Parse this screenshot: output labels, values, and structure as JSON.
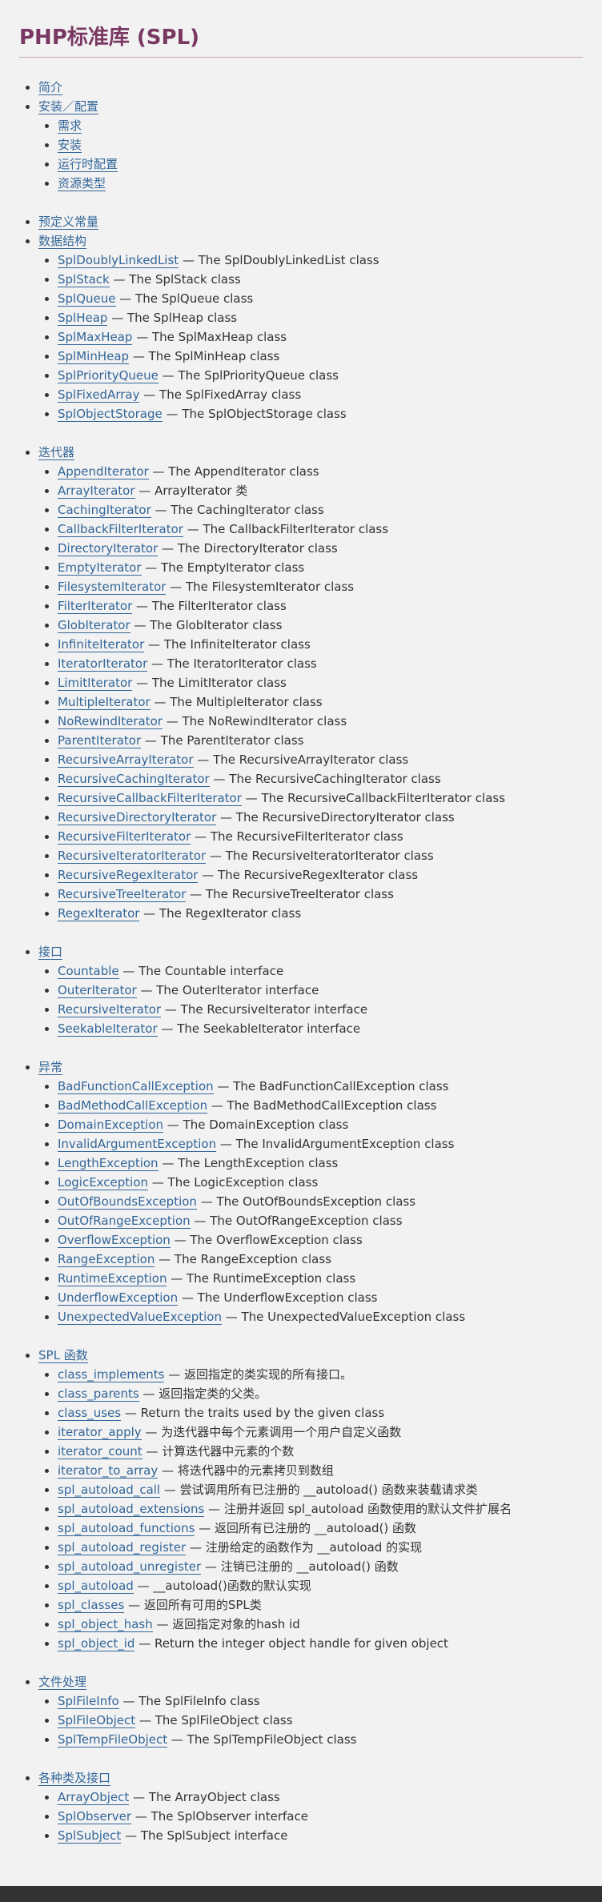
{
  "title": "PHP标准库 (SPL)",
  "separator": " — ",
  "sections": [
    {
      "label": "简介",
      "children": []
    },
    {
      "label": "安装／配置",
      "children": [
        {
          "link": "需求",
          "desc": ""
        },
        {
          "link": "安装",
          "desc": ""
        },
        {
          "link": "运行时配置",
          "desc": ""
        },
        {
          "link": "资源类型",
          "desc": ""
        }
      ]
    },
    {
      "label": "预定义常量",
      "children": []
    },
    {
      "label": "数据结构",
      "children": [
        {
          "link": "SplDoublyLinkedList",
          "desc": "The SplDoublyLinkedList class"
        },
        {
          "link": "SplStack",
          "desc": "The SplStack class"
        },
        {
          "link": "SplQueue",
          "desc": "The SplQueue class"
        },
        {
          "link": "SplHeap",
          "desc": "The SplHeap class"
        },
        {
          "link": "SplMaxHeap",
          "desc": "The SplMaxHeap class"
        },
        {
          "link": "SplMinHeap",
          "desc": "The SplMinHeap class"
        },
        {
          "link": "SplPriorityQueue",
          "desc": "The SplPriorityQueue class"
        },
        {
          "link": "SplFixedArray",
          "desc": "The SplFixedArray class"
        },
        {
          "link": "SplObjectStorage",
          "desc": "The SplObjectStorage class"
        }
      ]
    },
    {
      "label": "迭代器",
      "children": [
        {
          "link": "AppendIterator",
          "desc": "The AppendIterator class"
        },
        {
          "link": "ArrayIterator",
          "desc": "ArrayIterator 类"
        },
        {
          "link": "CachingIterator",
          "desc": "The CachingIterator class"
        },
        {
          "link": "CallbackFilterIterator",
          "desc": "The CallbackFilterIterator class"
        },
        {
          "link": "DirectoryIterator",
          "desc": "The DirectoryIterator class"
        },
        {
          "link": "EmptyIterator",
          "desc": "The EmptyIterator class"
        },
        {
          "link": "FilesystemIterator",
          "desc": "The FilesystemIterator class"
        },
        {
          "link": "FilterIterator",
          "desc": "The FilterIterator class"
        },
        {
          "link": "GlobIterator",
          "desc": "The GlobIterator class"
        },
        {
          "link": "InfiniteIterator",
          "desc": "The InfiniteIterator class"
        },
        {
          "link": "IteratorIterator",
          "desc": "The IteratorIterator class"
        },
        {
          "link": "LimitIterator",
          "desc": "The LimitIterator class"
        },
        {
          "link": "MultipleIterator",
          "desc": "The MultipleIterator class"
        },
        {
          "link": "NoRewindIterator",
          "desc": "The NoRewindIterator class"
        },
        {
          "link": "ParentIterator",
          "desc": "The ParentIterator class"
        },
        {
          "link": "RecursiveArrayIterator",
          "desc": "The RecursiveArrayIterator class"
        },
        {
          "link": "RecursiveCachingIterator",
          "desc": "The RecursiveCachingIterator class"
        },
        {
          "link": "RecursiveCallbackFilterIterator",
          "desc": "The RecursiveCallbackFilterIterator class"
        },
        {
          "link": "RecursiveDirectoryIterator",
          "desc": "The RecursiveDirectoryIterator class"
        },
        {
          "link": "RecursiveFilterIterator",
          "desc": "The RecursiveFilterIterator class"
        },
        {
          "link": "RecursiveIteratorIterator",
          "desc": "The RecursiveIteratorIterator class"
        },
        {
          "link": "RecursiveRegexIterator",
          "desc": "The RecursiveRegexIterator class"
        },
        {
          "link": "RecursiveTreeIterator",
          "desc": "The RecursiveTreeIterator class"
        },
        {
          "link": "RegexIterator",
          "desc": "The RegexIterator class"
        }
      ]
    },
    {
      "label": "接口",
      "children": [
        {
          "link": "Countable",
          "desc": "The Countable interface"
        },
        {
          "link": "OuterIterator",
          "desc": "The OuterIterator interface"
        },
        {
          "link": "RecursiveIterator",
          "desc": "The RecursiveIterator interface"
        },
        {
          "link": "SeekableIterator",
          "desc": "The SeekableIterator interface"
        }
      ]
    },
    {
      "label": "异常",
      "children": [
        {
          "link": "BadFunctionCallException",
          "desc": "The BadFunctionCallException class"
        },
        {
          "link": "BadMethodCallException",
          "desc": "The BadMethodCallException class"
        },
        {
          "link": "DomainException",
          "desc": "The DomainException class"
        },
        {
          "link": "InvalidArgumentException",
          "desc": "The InvalidArgumentException class"
        },
        {
          "link": "LengthException",
          "desc": "The LengthException class"
        },
        {
          "link": "LogicException",
          "desc": "The LogicException class"
        },
        {
          "link": "OutOfBoundsException",
          "desc": "The OutOfBoundsException class"
        },
        {
          "link": "OutOfRangeException",
          "desc": "The OutOfRangeException class"
        },
        {
          "link": "OverflowException",
          "desc": "The OverflowException class"
        },
        {
          "link": "RangeException",
          "desc": "The RangeException class"
        },
        {
          "link": "RuntimeException",
          "desc": "The RuntimeException class"
        },
        {
          "link": "UnderflowException",
          "desc": "The UnderflowException class"
        },
        {
          "link": "UnexpectedValueException",
          "desc": "The UnexpectedValueException class"
        }
      ]
    },
    {
      "label": "SPL 函数",
      "children": [
        {
          "link": "class_implements",
          "desc": "返回指定的类实现的所有接口。"
        },
        {
          "link": "class_parents",
          "desc": "返回指定类的父类。"
        },
        {
          "link": "class_uses",
          "desc": "Return the traits used by the given class"
        },
        {
          "link": "iterator_apply",
          "desc": "为迭代器中每个元素调用一个用户自定义函数"
        },
        {
          "link": "iterator_count",
          "desc": "计算迭代器中元素的个数"
        },
        {
          "link": "iterator_to_array",
          "desc": "将迭代器中的元素拷贝到数组"
        },
        {
          "link": "spl_autoload_call",
          "desc": "尝试调用所有已注册的 __autoload() 函数来装载请求类"
        },
        {
          "link": "spl_autoload_extensions",
          "desc": "注册并返回 spl_autoload 函数使用的默认文件扩展名"
        },
        {
          "link": "spl_autoload_functions",
          "desc": "返回所有已注册的 __autoload() 函数"
        },
        {
          "link": "spl_autoload_register",
          "desc": "注册给定的函数作为 __autoload 的实现"
        },
        {
          "link": "spl_autoload_unregister",
          "desc": "注销已注册的 __autoload() 函数"
        },
        {
          "link": "spl_autoload",
          "desc": "__autoload()函数的默认实现"
        },
        {
          "link": "spl_classes",
          "desc": "返回所有可用的SPL类"
        },
        {
          "link": "spl_object_hash",
          "desc": "返回指定对象的hash id"
        },
        {
          "link": "spl_object_id",
          "desc": "Return the integer object handle for given object"
        }
      ]
    },
    {
      "label": "文件处理",
      "children": [
        {
          "link": "SplFileInfo",
          "desc": "The SplFileInfo class"
        },
        {
          "link": "SplFileObject",
          "desc": "The SplFileObject class"
        },
        {
          "link": "SplTempFileObject",
          "desc": "The SplTempFileObject class"
        }
      ]
    },
    {
      "label": "各种类及接口",
      "children": [
        {
          "link": "ArrayObject",
          "desc": "The ArrayObject class"
        },
        {
          "link": "SplObserver",
          "desc": "The SplObserver interface"
        },
        {
          "link": "SplSubject",
          "desc": "The SplSubject interface"
        }
      ]
    }
  ]
}
